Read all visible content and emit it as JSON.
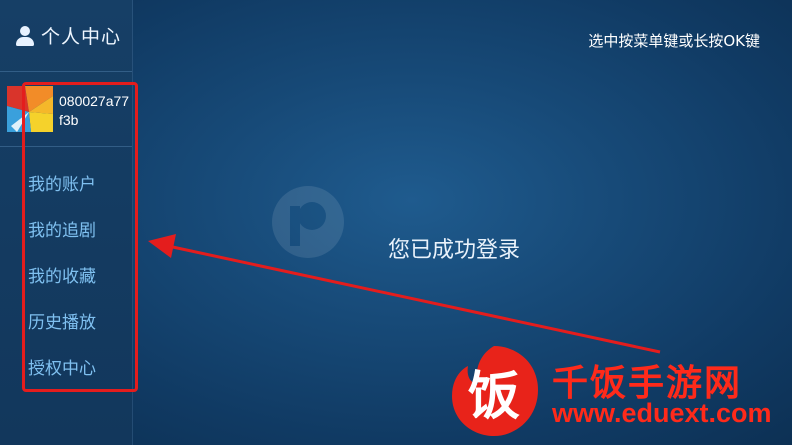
{
  "sidebar": {
    "title": "个人中心",
    "user_id": "080027a77f3b",
    "menu": [
      {
        "label": "我的账户"
      },
      {
        "label": "我的追剧"
      },
      {
        "label": "我的收藏"
      },
      {
        "label": "历史播放"
      },
      {
        "label": "授权中心"
      }
    ]
  },
  "header": {
    "hint": "选中按菜单键或长按OK键"
  },
  "main": {
    "status": "您已成功登录"
  },
  "watermark": {
    "brand": "千饭手游网",
    "url": "www.eduext.com",
    "logo_char": "饭"
  },
  "annotation": {
    "color": "#e41d1d"
  }
}
